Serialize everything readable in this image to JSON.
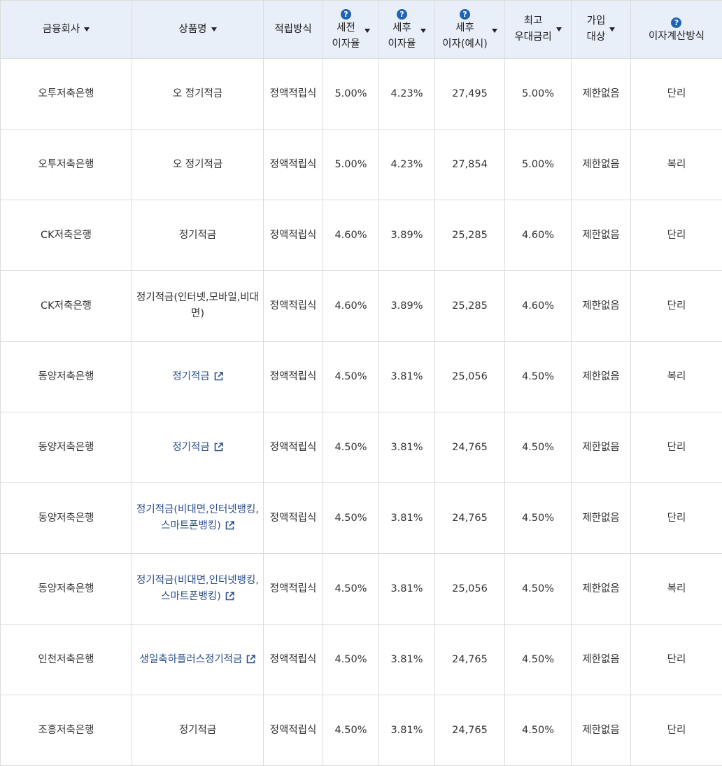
{
  "header": {
    "company": "금융회사",
    "product": "상품명",
    "method": "적립방식",
    "pre_tax_1": "세전",
    "pre_tax_2": "이자율",
    "post_tax_1": "세후",
    "post_tax_2": "이자율",
    "post_interest_1": "세후",
    "post_interest_2": "이자(예시)",
    "max_rate_1": "최고",
    "max_rate_2": "우대금리",
    "target_1": "가입",
    "target_2": "대상",
    "calc": "이자계산방식",
    "help_glyph": "?"
  },
  "rows": [
    {
      "company": "오투저축은행",
      "product": "오 정기적금",
      "link": false,
      "method": "정액적립식",
      "pre": "5.00%",
      "post": "4.23%",
      "interest": "27,495",
      "max": "5.00%",
      "target": "제한없음",
      "calc": "단리"
    },
    {
      "company": "오투저축은행",
      "product": "오 정기적금",
      "link": false,
      "method": "정액적립식",
      "pre": "5.00%",
      "post": "4.23%",
      "interest": "27,854",
      "max": "5.00%",
      "target": "제한없음",
      "calc": "복리"
    },
    {
      "company": "CK저축은행",
      "product": "정기적금",
      "link": false,
      "method": "정액적립식",
      "pre": "4.60%",
      "post": "3.89%",
      "interest": "25,285",
      "max": "4.60%",
      "target": "제한없음",
      "calc": "단리"
    },
    {
      "company": "CK저축은행",
      "product": "정기적금(인터넷,모바일,비대면)",
      "link": false,
      "method": "정액적립식",
      "pre": "4.60%",
      "post": "3.89%",
      "interest": "25,285",
      "max": "4.60%",
      "target": "제한없음",
      "calc": "단리"
    },
    {
      "company": "동양저축은행",
      "product": "정기적금",
      "link": true,
      "method": "정액적립식",
      "pre": "4.50%",
      "post": "3.81%",
      "interest": "25,056",
      "max": "4.50%",
      "target": "제한없음",
      "calc": "복리"
    },
    {
      "company": "동양저축은행",
      "product": "정기적금",
      "link": true,
      "method": "정액적립식",
      "pre": "4.50%",
      "post": "3.81%",
      "interest": "24,765",
      "max": "4.50%",
      "target": "제한없음",
      "calc": "단리"
    },
    {
      "company": "동양저축은행",
      "product": "정기적금(비대면,인터넷뱅킹,스마트폰뱅킹)",
      "link": true,
      "method": "정액적립식",
      "pre": "4.50%",
      "post": "3.81%",
      "interest": "24,765",
      "max": "4.50%",
      "target": "제한없음",
      "calc": "단리"
    },
    {
      "company": "동양저축은행",
      "product": "정기적금(비대면,인터넷뱅킹,스마트폰뱅킹)",
      "link": true,
      "method": "정액적립식",
      "pre": "4.50%",
      "post": "3.81%",
      "interest": "25,056",
      "max": "4.50%",
      "target": "제한없음",
      "calc": "복리"
    },
    {
      "company": "인천저축은행",
      "product": "생일축하플러스정기적금",
      "link": true,
      "method": "정액적립식",
      "pre": "4.50%",
      "post": "3.81%",
      "interest": "24,765",
      "max": "4.50%",
      "target": "제한없음",
      "calc": "단리"
    },
    {
      "company": "조흥저축은행",
      "product": "정기적금",
      "link": false,
      "method": "정액적립식",
      "pre": "4.50%",
      "post": "3.81%",
      "interest": "24,765",
      "max": "4.50%",
      "target": "제한없음",
      "calc": "단리"
    }
  ]
}
